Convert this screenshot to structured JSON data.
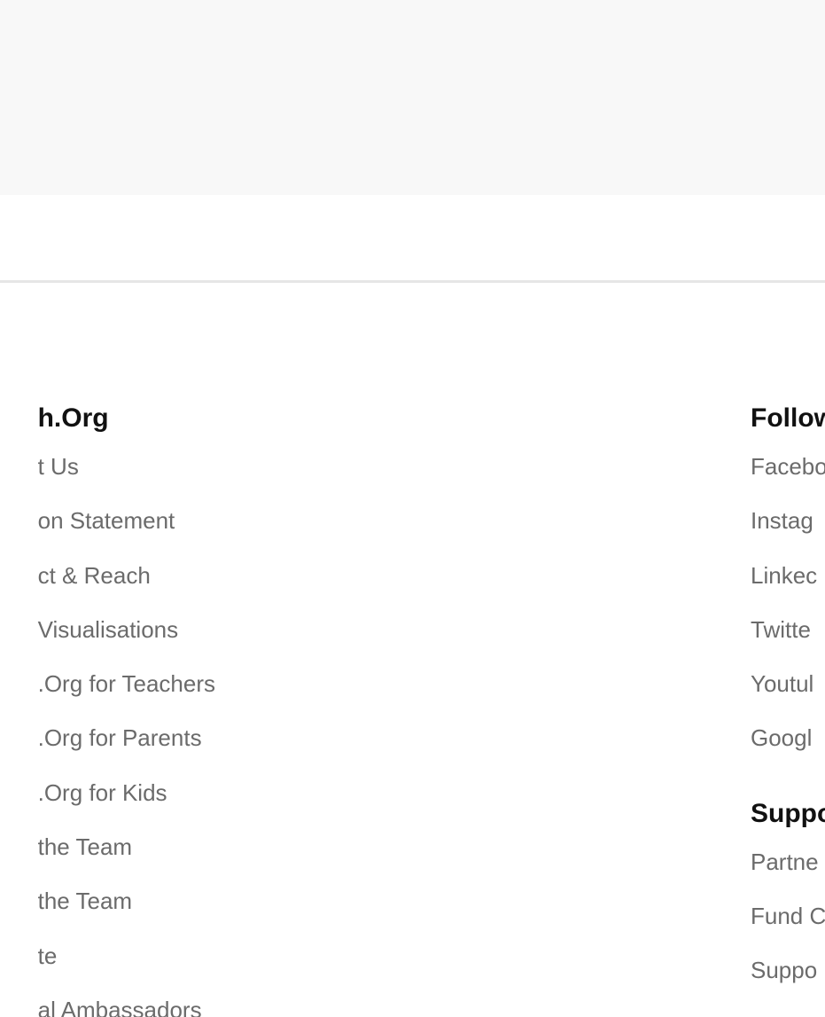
{
  "footer": {
    "left_column": {
      "heading": "h.Org",
      "links": [
        "t Us",
        "on Statement",
        "ct & Reach",
        "Visualisations",
        ".Org for Teachers",
        ".Org for Parents",
        ".Org for Kids",
        " the Team",
        "the Team",
        "te",
        "al Ambassadors"
      ]
    },
    "follow": {
      "heading": "Follow",
      "links": [
        "Facebo",
        "Instag",
        "Linkec",
        "Twitte",
        "Youtul",
        "Googl"
      ]
    },
    "support": {
      "heading": "Suppo",
      "links": [
        "Partne",
        "Fund C",
        "Suppo"
      ]
    }
  },
  "colors": {
    "top_band": "#f8f8f8",
    "divider": "#e6e6e6",
    "heading_text": "#111111",
    "link_text": "#6b6b6b"
  }
}
